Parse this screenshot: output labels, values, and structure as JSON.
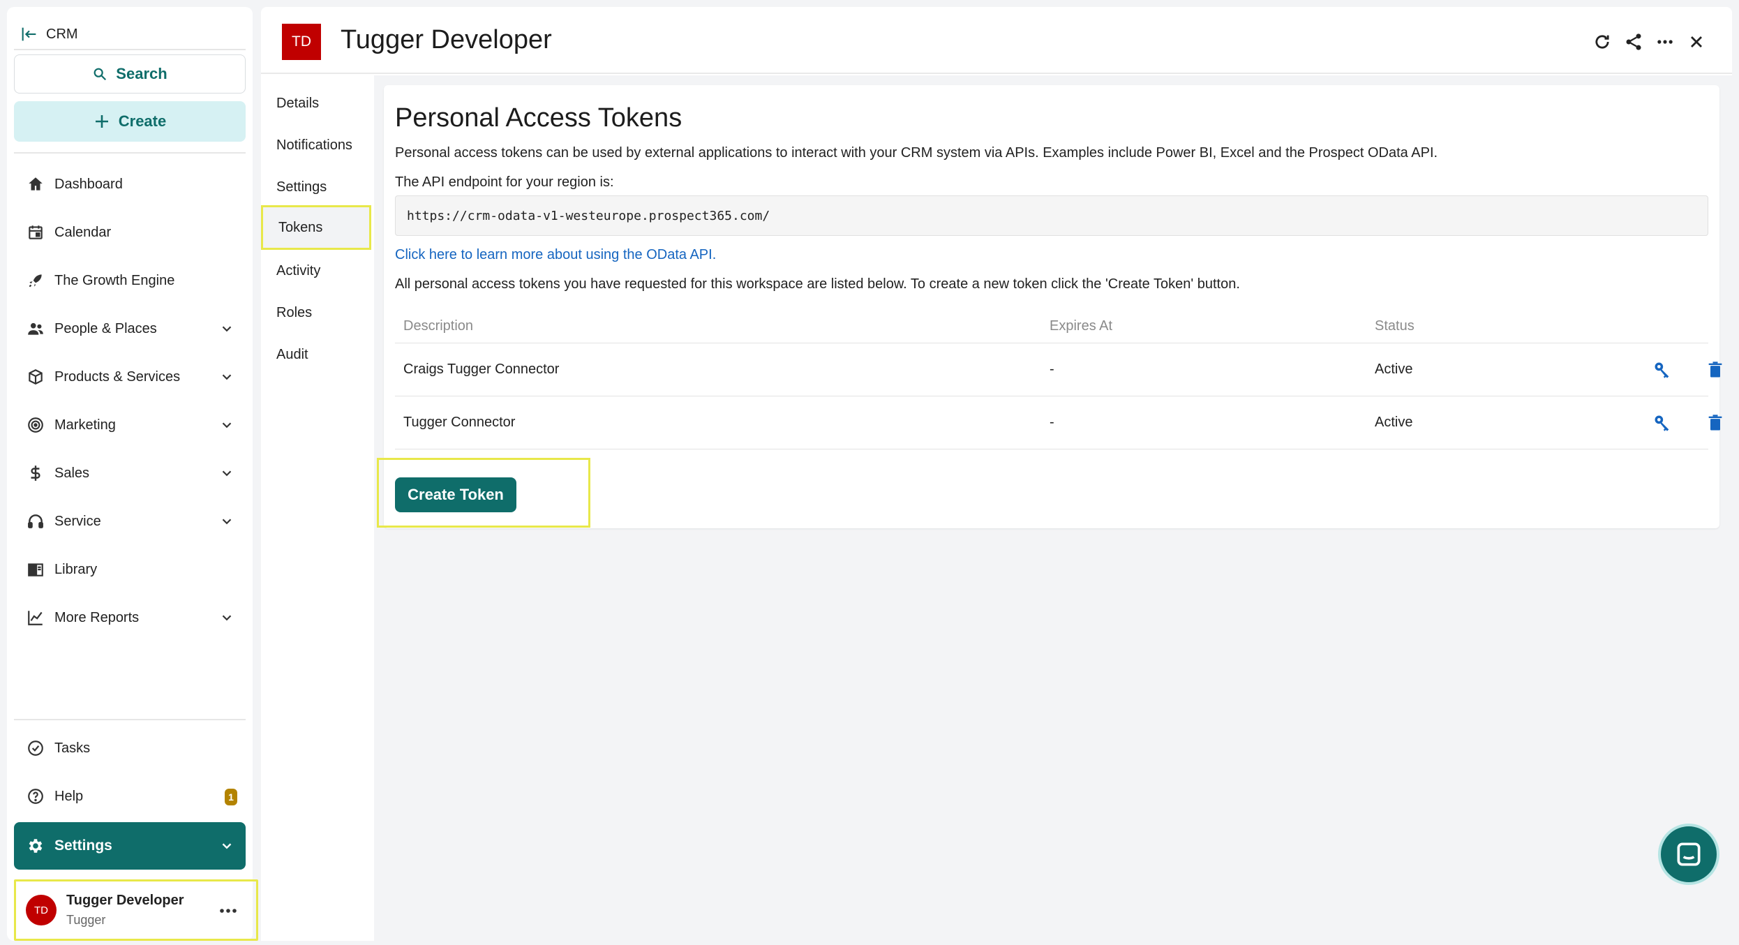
{
  "sidebar": {
    "back_label": "CRM",
    "search_label": "Search",
    "create_label": "Create",
    "items": [
      {
        "label": "Dashboard",
        "icon": "home-icon"
      },
      {
        "label": "Calendar",
        "icon": "calendar-icon"
      },
      {
        "label": "The Growth Engine",
        "icon": "rocket-icon"
      },
      {
        "label": "People & Places",
        "icon": "people-icon",
        "expandable": true
      },
      {
        "label": "Products & Services",
        "icon": "box-icon",
        "expandable": true
      },
      {
        "label": "Marketing",
        "icon": "target-icon",
        "expandable": true
      },
      {
        "label": "Sales",
        "icon": "dollar-icon",
        "expandable": true
      },
      {
        "label": "Service",
        "icon": "headset-icon",
        "expandable": true
      },
      {
        "label": "Library",
        "icon": "book-icon"
      },
      {
        "label": "More Reports",
        "icon": "chart-icon",
        "expandable": true
      }
    ],
    "bottom_items": [
      {
        "label": "Tasks",
        "icon": "check-circle-icon"
      },
      {
        "label": "Help",
        "icon": "help-icon",
        "badge": "1"
      }
    ],
    "settings_label": "Settings",
    "user": {
      "initials": "TD",
      "name": "Tugger Developer",
      "org": "Tugger"
    }
  },
  "header": {
    "initials": "TD",
    "title": "Tugger Developer"
  },
  "subnav": {
    "items": [
      "Details",
      "Notifications",
      "Settings",
      "Tokens",
      "Activity",
      "Roles",
      "Audit"
    ],
    "active": "Tokens"
  },
  "tokens_page": {
    "title": "Personal Access Tokens",
    "description": "Personal access tokens can be used by external applications to interact with your CRM system via APIs. Examples include Power BI, Excel and the Prospect OData API.",
    "endpoint_label": "The API endpoint for your region is:",
    "endpoint_url": "https://crm-odata-v1-westeurope.prospect365.com/",
    "link_text": "Click here to learn more about using the OData API.",
    "list_description": "All personal access tokens you have requested for this workspace are listed below. To create a new token click the 'Create Token' button.",
    "columns": [
      "Description",
      "Expires At",
      "Status"
    ],
    "rows": [
      {
        "description": "Craigs Tugger Connector",
        "expires": "-",
        "status": "Active"
      },
      {
        "description": "Tugger Connector",
        "expires": "-",
        "status": "Active"
      }
    ],
    "create_button": "Create Token"
  },
  "colors": {
    "brand": "#0f6d6a",
    "create_bg": "#d6f1f3",
    "avatar": "#c00000",
    "link": "#1565c0",
    "highlight": "#e8e84a"
  }
}
